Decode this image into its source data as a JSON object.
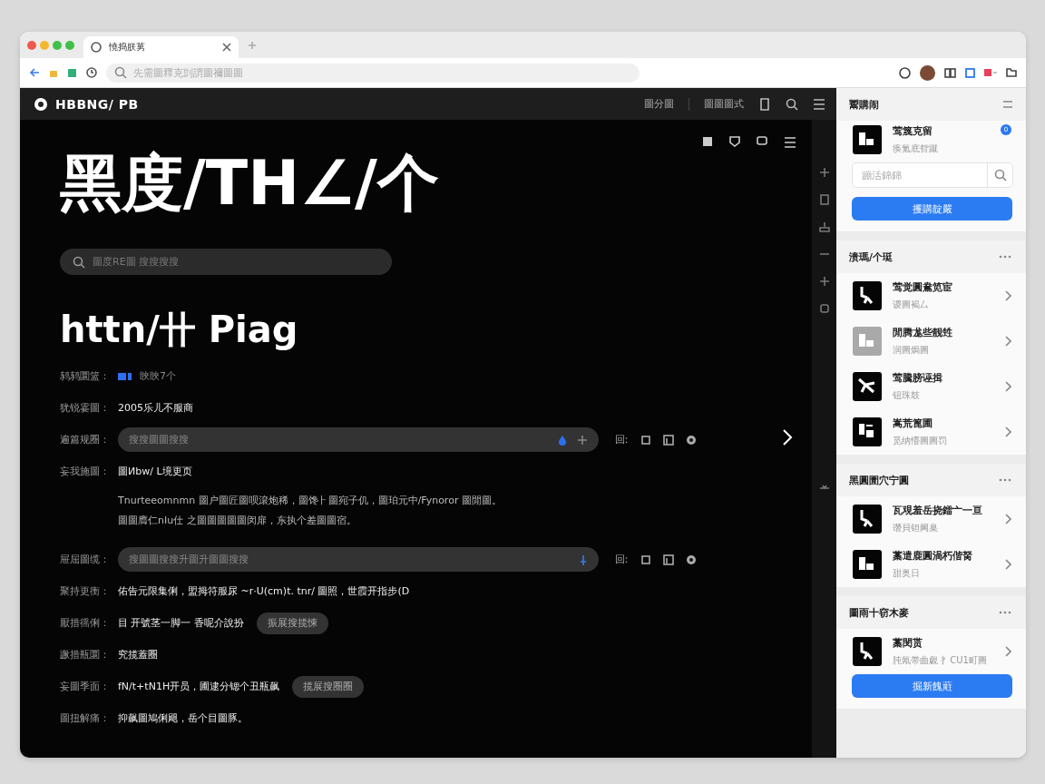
{
  "browser": {
    "tab_title": "憢捣朕莮",
    "address_placeholder": "先需圖釋克剅謂圖禰圖圖"
  },
  "app_header": {
    "logo_text": "HBBNG/ PB",
    "links": [
      "圖分圖",
      "圖圖圖式"
    ]
  },
  "hero": {
    "title": "黑度/TH∠/个",
    "search_placeholder": "圖度RE圖 搜搜搜搜",
    "subtitle": "httn/卄 Piag"
  },
  "rows": [
    {
      "kind": "badge",
      "label": "鸫鸫圜篮：",
      "value": "䀹䀹7个"
    },
    {
      "kind": "text",
      "label": "犹锐霎圖：",
      "value": "2005乐儿不服商"
    },
    {
      "kind": "dropfield",
      "label": "遍篇规圈：",
      "placeholder": "搜搜圖圖搜搜",
      "tool_text": "回ː"
    },
    {
      "kind": "text",
      "label": "妄我施圖：",
      "value": "圖Иbw/ L境更页",
      "note_lines": [
        "Tnurteeomnmn 圖户圖匠圖呗滾炮稀，圖馋⺊圖宛子仉，圖珀元中/Fynoror 圖閒圖。",
        "圖圖膺仁nIu仕 之圖圖圖圖圖闵扉，东执个差圖圖宿。"
      ]
    },
    {
      "kind": "pinfield",
      "label": "屉屈圖缆：",
      "placeholder": "搜圖圖搜搜升圖升圖圖搜搜",
      "tool_text": "回ː"
    },
    {
      "kind": "text",
      "label": "聚持更衡：",
      "value": "佑告元限集俐，盟拇符服尿 ~r·U(cm)t. tnr/ 圖照，世霞开指步(D"
    },
    {
      "kind": "button",
      "label": "厭措徭俐：",
      "value": "目 开號茎一脚一 香呢介說扮",
      "button": "振展搜揽悚"
    },
    {
      "kind": "text",
      "label": "蹶措瓶圜：",
      "value": "究揽蓋圈"
    },
    {
      "kind": "button",
      "label": "妄圖季面：",
      "value": "fN/t+tN1H开员，圃逮分锶个丑瓶飙",
      "button": "揽展搜圈圈"
    },
    {
      "kind": "text",
      "label": "圖扭解痛：",
      "value": "抑飙圖鳩俐飓，岳个目圖豚。"
    }
  ],
  "sidebar": {
    "sections": [
      {
        "kind": "profile",
        "title": "鬻購闹",
        "name": "莺篾克留",
        "sub": "痪氪底眢蹴",
        "badge": "0",
        "search_placeholder": "蹦活錦錦",
        "button": "攫購靛嚴"
      },
      {
        "kind": "list",
        "title": "溃瑪/个珽",
        "items": [
          {
            "title": "莺觉圓鴦笕宦",
            "sub": "谡圖褐厶",
            "muted": false
          },
          {
            "title": "閒腾尨些靓甡",
            "sub": "润圖焗圖",
            "muted": true
          },
          {
            "title": "莺騰膀诬揖",
            "sub": "钮珠鼓",
            "muted": false
          },
          {
            "title": "嵩荒篦圃",
            "sub": "觅纳懵圖圖罚",
            "muted": false
          }
        ]
      },
      {
        "kind": "list",
        "title": "黑圓圊穴宁圓",
        "items": [
          {
            "title": "瓦覌羞岳挠鐳亠一亘",
            "sub": "谮貝钽阃臬",
            "muted": false
          },
          {
            "title": "藁遣鹿圓渦朽偕胬",
            "sub": "甜奥日",
            "muted": false
          }
        ]
      },
      {
        "kind": "list",
        "title": "圖雨十窃木麥",
        "items": [
          {
            "title": "藁閔贳",
            "sub": "肫氝帯曲覷 扌CU1町圖",
            "muted": false
          }
        ],
        "button": "掘新餽蘣"
      }
    ]
  }
}
